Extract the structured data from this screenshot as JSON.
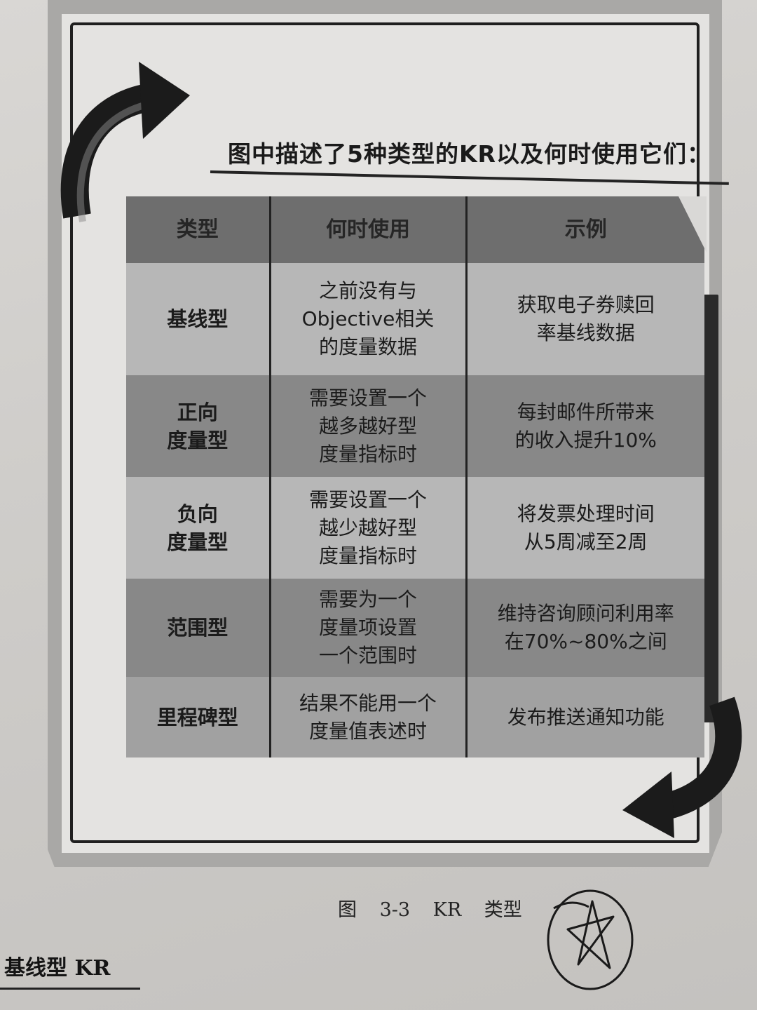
{
  "figure": {
    "heading": "图中描述了5种类型的KR以及何时使用它们：",
    "table": {
      "headers": [
        "类型",
        "何时使用",
        "示例"
      ],
      "rows": [
        {
          "type": [
            "基线型"
          ],
          "when": [
            "之前没有与",
            "Objective相关",
            "的度量数据"
          ],
          "example": [
            "获取电子券赎回",
            "率基线数据"
          ]
        },
        {
          "type": [
            "正向",
            "度量型"
          ],
          "when": [
            "需要设置一个",
            "越多越好型",
            "度量指标时"
          ],
          "example": [
            "每封邮件所带来",
            "的收入提升10%"
          ]
        },
        {
          "type": [
            "负向",
            "度量型"
          ],
          "when": [
            "需要设置一个",
            "越少越好型",
            "度量指标时"
          ],
          "example": [
            "将发票处理时间",
            "从5周减至2周"
          ]
        },
        {
          "type": [
            "范围型"
          ],
          "when": [
            "需要为一个",
            "度量项设置",
            "一个范围时"
          ],
          "example": [
            "维持咨询顾问利用率",
            "在70%~80%之间"
          ]
        },
        {
          "type": [
            "里程碑型"
          ],
          "when": [
            "结果不能用一个",
            "度量值表述时"
          ],
          "example": [
            "发布推送通知功能"
          ]
        }
      ]
    }
  },
  "caption": "图 3-3 KR 类型",
  "section_title": "基线型 KR",
  "icons": {
    "top_arrow": "curved-arrow-right-icon",
    "bottom_arrow": "curved-arrow-left-icon",
    "doodle": "hand-drawn-star-circle-icon"
  }
}
